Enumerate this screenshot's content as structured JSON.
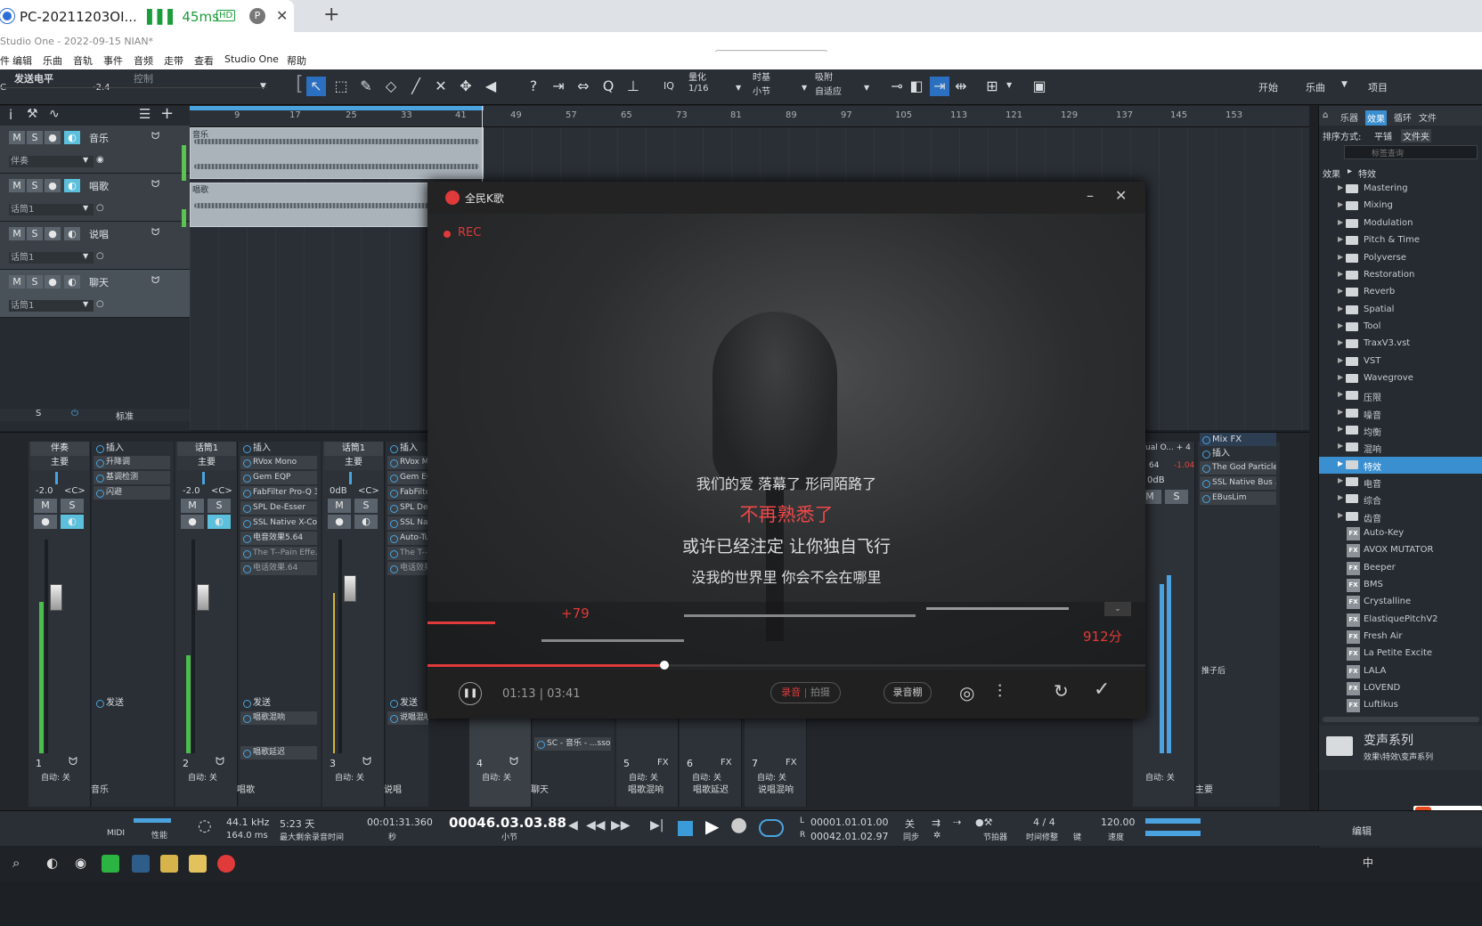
{
  "browser": {
    "tab_title": "PC-20211203OI...",
    "ping": "45ms",
    "hd_badge": "HD",
    "profile_letter": "P",
    "close": "✕",
    "new_tab": "+"
  },
  "app": {
    "title": "Studio One - 2022-09-15 NIAN*",
    "menu": [
      "件",
      "编辑",
      "乐曲",
      "音轨",
      "事件",
      "音频",
      "走带",
      "查看",
      "Studio One",
      "帮助"
    ]
  },
  "toolbar": {
    "send_level_label": "发送电平",
    "send_value": "-2.4",
    "send_short": "C",
    "control_label": "控制",
    "quantize_label": "量化",
    "quantize_value": "1/16",
    "timebase_label": "时基",
    "timebase_value": "小节",
    "snap_label": "吸附",
    "snap_value": "自适应",
    "iq": "IQ",
    "right_buttons": [
      "开始",
      "乐曲",
      "项目"
    ]
  },
  "tracks": [
    {
      "name": "音乐",
      "input": "伴奏",
      "m": "M",
      "s": "S"
    },
    {
      "name": "唱歌",
      "input": "话筒1",
      "m": "M",
      "s": "S"
    },
    {
      "name": "说唱",
      "input": "话筒1",
      "m": "M",
      "s": "S"
    },
    {
      "name": "聊天",
      "input": "话筒1",
      "m": "M",
      "s": "S"
    }
  ],
  "ruler": [
    "9",
    "17",
    "25",
    "33",
    "41",
    "49",
    "57",
    "65",
    "73",
    "81",
    "89",
    "97",
    "105",
    "113",
    "121",
    "129",
    "137",
    "145",
    "153"
  ],
  "clips": [
    {
      "label": "音乐"
    },
    {
      "label": "唱歌"
    }
  ],
  "browser_panel": {
    "tabs": [
      "乐器",
      "效果",
      "循环",
      "文件"
    ],
    "sort_label": "排序方式:",
    "sort_options": [
      "平铺",
      "文件夹"
    ],
    "search_placeholder": "标签查询",
    "breadcrumb": [
      "效果",
      "特效"
    ],
    "folders": [
      "Mastering",
      "Mixing",
      "Modulation",
      "Pitch & Time",
      "Polyverse",
      "Restoration",
      "Reverb",
      "Spatial",
      "Tool",
      "TraxV3.vst",
      "VST",
      "Wavegrove",
      "压限",
      "噪音",
      "均衡",
      "混响",
      "特效",
      "电音",
      "综合",
      "齿音"
    ],
    "plugins": [
      "Auto-Key",
      "AVOX MUTATOR",
      "Beeper",
      "BMS",
      "Crystalline",
      "ElastiquePitchV2",
      "Fresh Air",
      "La Petite Excite",
      "LALA",
      "LOVEND",
      "Luftikus"
    ],
    "fx_badge": "FX",
    "preset_title": "变声系列",
    "preset_path": "效果\\特效\\变声系列"
  },
  "mixer": {
    "header": {
      "s_label": "S",
      "standard": "标准"
    },
    "channels": [
      {
        "name": "伴奏",
        "bus": "主要",
        "vol": "-2.0",
        "pan": "<C>",
        "num": "1",
        "label": "音乐",
        "auto": "自动: 关"
      },
      {
        "name": "话筒1",
        "bus": "主要",
        "vol": "-2.0",
        "pan": "<C>",
        "num": "2",
        "label": "唱歌",
        "auto": "自动: 关"
      },
      {
        "name": "话筒1",
        "bus": "主要",
        "vol": "0dB",
        "pan": "<C>",
        "num": "3",
        "label": "说唱",
        "auto": "自动: 关"
      },
      {
        "num": "4",
        "label": "聊天",
        "auto": "自动: 关"
      },
      {
        "num": "5",
        "label": "唱歌混响",
        "auto": "自动: 关",
        "fx": "FX"
      },
      {
        "num": "6",
        "label": "唱歌延迟",
        "auto": "自动: 关",
        "fx": "FX"
      },
      {
        "num": "7",
        "label": "说唱混响",
        "auto": "自动: 关",
        "fx": "FX"
      }
    ],
    "inserts": [
      {
        "header": "插入",
        "items": [
          "升降调",
          "基调检测",
          "闪避"
        ],
        "send": "发送",
        "sends": []
      },
      {
        "header": "插入",
        "items": [
          "RVox Mono",
          "Gem EQP",
          "FabFilter Pro-Q 3",
          "SPL De-Esser",
          "SSL Native X-Co...",
          "电音效果5.64",
          "The T--Pain Effe...",
          "电话效果.64"
        ],
        "send": "发送",
        "sends": [
          "唱歌混响",
          "唱歌延迟"
        ]
      },
      {
        "header": "插入",
        "items": [
          "RVox M",
          "Gem EC",
          "FabFilter",
          "SPL De-",
          "SSL Nat",
          "Auto-Tu",
          "The T--F",
          "电话效果"
        ],
        "send": "发送",
        "sends": [
          "说唱混响"
        ]
      }
    ],
    "sc_item": "SC - 音乐 - ...ssor",
    "right": {
      "virtual": "ual O... + 4",
      "values": [
        "64",
        "-1.04"
      ],
      "odb": "0dB",
      "main_label": "主要",
      "mix_fx": "Mix FX",
      "insert": "插入",
      "plugins": [
        "The God Particle",
        "SSL Native Bus ...",
        "EBusLim"
      ],
      "post": "推子后",
      "auto": "自动: 关"
    },
    "scale": [
      "6",
      "0",
      "-3",
      "-6",
      "-12",
      "-24",
      "-36",
      "-48",
      "-60",
      "-72"
    ]
  },
  "transport": {
    "midi": "MIDI",
    "perf": "性能",
    "sample_rate": "44.1 kHz",
    "latency": "164.0 ms",
    "days": "5:23 天",
    "rec_time_label": "最大剩余录音时间",
    "seconds": "00:01:31.360",
    "sec_label": "秒",
    "bars": "00046.03.03.88",
    "bars_label": "小节",
    "loop_l": "00001.01.01.00",
    "loop_r": "00042.01.02.97",
    "sync": "关",
    "sync_label": "同步",
    "metronome_label": "节拍器",
    "sig": "4 / 4",
    "sig_label": "时间修整",
    "key_label": "键",
    "tempo": "120.00",
    "tempo_label": "速度",
    "edit": "编辑"
  },
  "karaoke": {
    "app_name": "全民K歌",
    "rec": "REC",
    "lyrics": [
      "我们的爱 落幕了 形同陌路了",
      "不再熟悉了",
      "或许已经注定 让你独自飞行",
      "没我的世界里 你会不会在哪里"
    ],
    "score_delta": "+79",
    "score": "912分",
    "time": "01:13 | 03:41",
    "record_tabs": [
      "录音",
      "拍摄"
    ],
    "studio": "录音棚",
    "progress": 0.33,
    "colors": {
      "accent": "#e03a3a",
      "active_lyric": "#f04848"
    }
  },
  "ime": {
    "logo": "S",
    "lang": "中"
  },
  "taskbar": {
    "lang": "中"
  }
}
